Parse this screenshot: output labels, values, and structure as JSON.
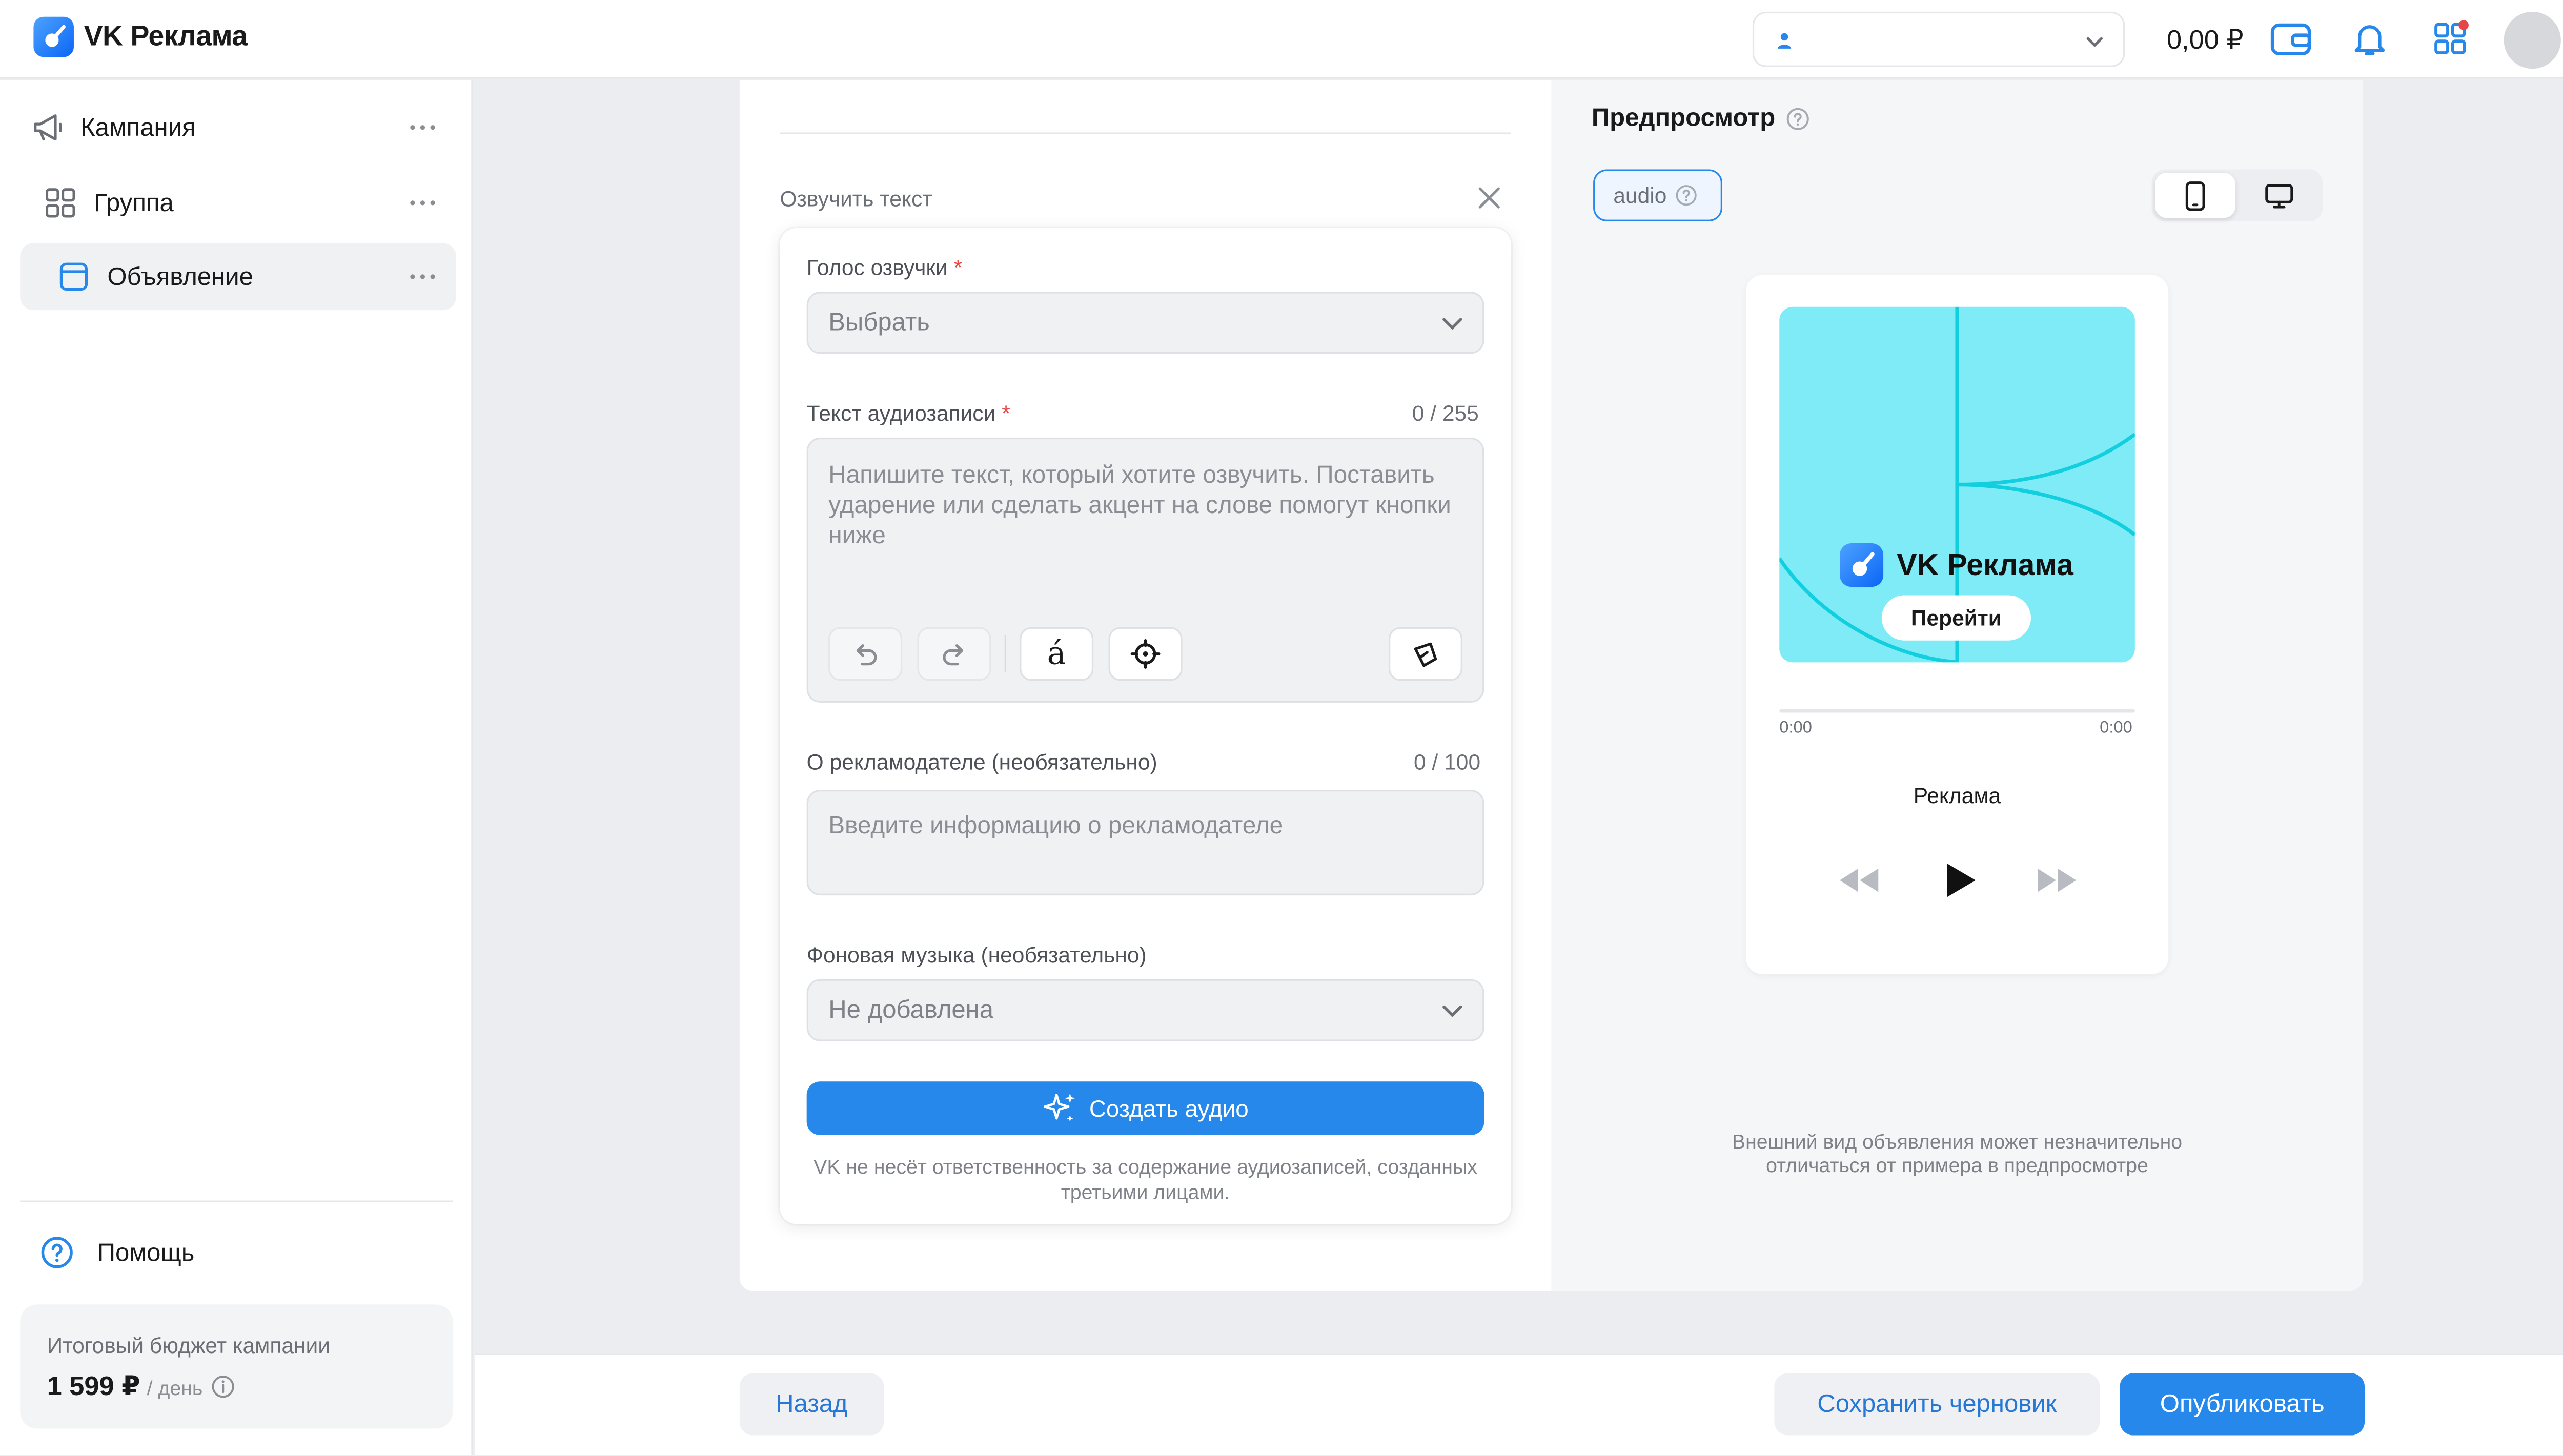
{
  "app": {
    "title": "VK Реклама",
    "balance": "0,00 ₽"
  },
  "sidebar": {
    "items": [
      {
        "label": "Кампания"
      },
      {
        "label": "Группа"
      },
      {
        "label": "Объявление"
      }
    ],
    "help": "Помощь",
    "budget": {
      "label": "Итоговый бюджет кампании",
      "value": "1 599 ₽",
      "unit": "/ день"
    }
  },
  "voice": {
    "title": "Озвучить текст",
    "voice_label": "Голос озвучки",
    "voice_value": "Выбрать",
    "text_label": "Текст аудиозаписи",
    "text_counter": "0 / 255",
    "text_placeholder": "Напишите текст, который хотите озвучить. Поставить ударение или сделать акцент на слове помогут кнопки ниже",
    "accent_char": "á",
    "advertiser_label": "О рекламодателе (необязательно)",
    "advertiser_counter": "0 / 100",
    "advertiser_placeholder": "Введите информацию о рекламодателе",
    "music_label": "Фоновая музыка (необязательно)",
    "music_value": "Не добавлена",
    "create_button": "Создать аудио",
    "disclaimer": "VK не несёт ответственность за содержание аудиозаписей, созданных третьими лицами."
  },
  "preview": {
    "title": "Предпросмотр",
    "chip": "audio",
    "art_brand": "VK Реклама",
    "go_button": "Перейти",
    "time_start": "0:00",
    "time_end": "0:00",
    "track_title": "Реклама",
    "note": "Внешний вид объявления может незначительно отличаться от примера в предпросмотре"
  },
  "footer": {
    "back": "Назад",
    "save_draft": "Сохранить черновик",
    "publish": "Опубликовать"
  },
  "colors": {
    "accent": "#2688eb",
    "art_bg": "#7eebf6",
    "art_lines": "#12cfe0"
  }
}
